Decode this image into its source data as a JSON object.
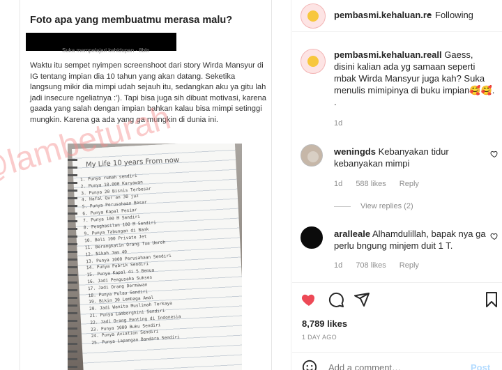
{
  "post": {
    "question": "Foto apa yang membuatmu merasa malu?",
    "meta_line": "Suka mempelajari kehidupan · 8bln",
    "story_text": "Waktu itu sempet nyimpen screenshoot dari story Wirda Mansyur di IG tentang impian dia 10 tahun yang akan datang. Seketika langsung mikir dia mimpi udah sejauh itu, sedangkan aku ya gitu lah jadi insecure ngeliatnya :'). Tapi bisa juga sih dibuat motivasi, karena gaada yang salah dengan impian bahkan kalau bisa mimpi setinggi mungkin. Karena ga ada yang ga mungkin di dunia ini.",
    "notebook_title": "My Life 10 years From now",
    "notebook_items": [
      "1. Punya rumah sendiri",
      "2. Punya 10.000 Karyawan",
      "3. Punya 20 Bisnis Terbesar",
      "4. Hafal Qur'an 30 juz",
      "5. Punya Perusahaan Besar",
      "6. Punya Kapal Pesiar",
      "7. Punya 100 M Sendiri",
      "8. Penghasilan 100 M Sendiri",
      "9. Punya Tabungan di Bank",
      "10. Beli 100 Private Jet",
      "11. Berangkatin Orang Tua Umroh",
      "12. Nikah Jam 40",
      "13. Punya 1000 Perusahaan Sendiri",
      "14. Punya Pabrik Sendiri",
      "15. Punya Kapal di 5 Benua",
      "16. Jadi Pengusaha Sukses",
      "17. Jadi Orang Dermawan",
      "18. Punya Pulau Sendiri",
      "19. Bikin 30 Lembaga Amal",
      "20. Jadi Wanita Muslimah Terkaya",
      "21. Punya Lamborghini Sendiri",
      "22. Jadi Orang Penting di Indonesia",
      "23. Punya 1000 Buku Sendiri",
      "24. Punya Aviation Sendiri",
      "25. Punya Lapangan Bandara Sendiri"
    ],
    "watermark": "@lambeturah"
  },
  "header": {
    "username": "pembasmi.kehaluan.real",
    "dot": "•",
    "follow_label": "Following"
  },
  "caption": {
    "username": "pembasmi.kehaluan.reall",
    "text": "Gaess, disini kalian ada yg samaan seperti mbak Wirda Mansyur juga kah? Suka menulis mimipinya di buku impian🥰🥰.",
    "dot": ".",
    "time": "1d"
  },
  "comments": [
    {
      "username": "weningds",
      "text": "Kebanyakan tidur kebanyakan mimpi",
      "time": "1d",
      "likes": "588 likes",
      "reply": "Reply"
    },
    {
      "username": "aralleale",
      "text": "Alhamdulillah, bapak nya ga perlu bngung minjem duit 1 T.",
      "time": "1d",
      "likes": "708 likes",
      "reply": "Reply"
    }
  ],
  "view_replies": "View replies (2)",
  "actions": {
    "likes": "8,789 likes",
    "date": "1 DAY AGO"
  },
  "add_comment": {
    "placeholder": "Add a comment…",
    "post_label": "Post"
  },
  "colors": {
    "accent": "#ed4956",
    "post_disabled": "#b3dbff",
    "muted": "#8e8e8e"
  },
  "icons": [
    "heart-filled-icon",
    "comment-icon",
    "share-icon",
    "bookmark-icon",
    "emoji-icon",
    "heart-outline-icon"
  ]
}
